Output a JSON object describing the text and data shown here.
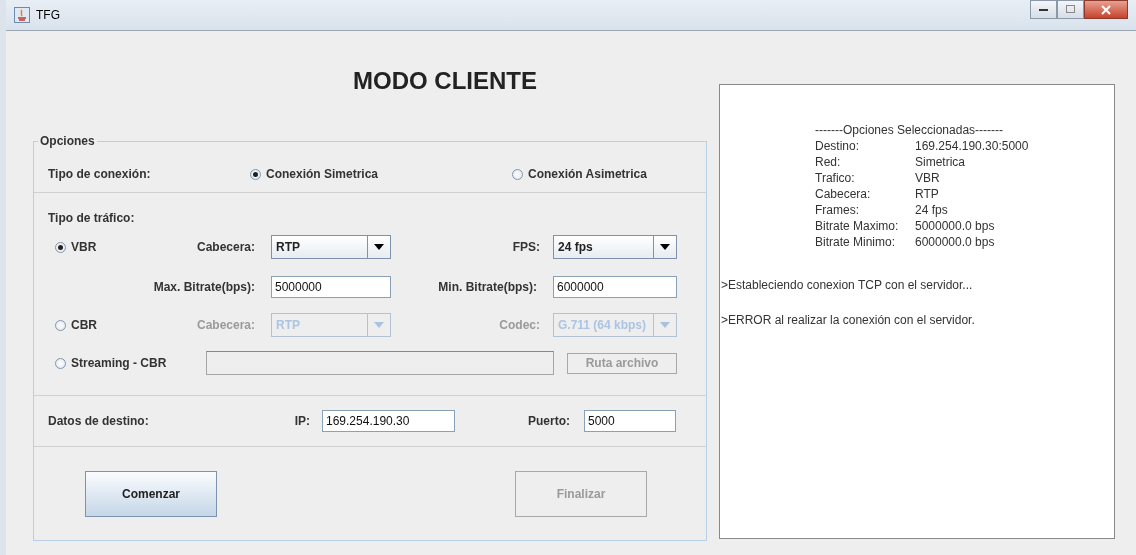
{
  "window": {
    "title": "TFG"
  },
  "heading": "MODO CLIENTE",
  "options": {
    "legend": "Opciones",
    "connection": {
      "label": "Tipo de conexión:",
      "choices": [
        {
          "label": "Conexión Simetrica",
          "selected": true
        },
        {
          "label": "Conexión Asimetrica",
          "selected": false
        }
      ]
    },
    "traffic_label": "Tipo de tráfico:",
    "vbr": {
      "label": "VBR",
      "selected": true,
      "header": {
        "label": "Cabecera:",
        "value": "RTP",
        "disabled": false
      },
      "fps": {
        "label": "FPS:",
        "value": "24 fps",
        "disabled": false
      },
      "max_bitrate": {
        "label": "Max. Bitrate(bps):",
        "value": "5000000"
      },
      "min_bitrate": {
        "label": "Min. Bitrate(bps):",
        "value": "6000000"
      }
    },
    "cbr": {
      "label": "CBR",
      "selected": false,
      "header": {
        "label": "Cabecera:",
        "value": "RTP",
        "disabled": true
      },
      "codec": {
        "label": "Codec:",
        "value": "G.711 (64 kbps)",
        "disabled": true
      }
    },
    "streaming": {
      "label": "Streaming - CBR",
      "selected": false,
      "path_disabled": true,
      "browse_button": {
        "label": "Ruta archivo",
        "disabled": true
      }
    },
    "destination": {
      "label": "Datos de destino:",
      "ip": {
        "label": "IP:",
        "value": "169.254.190.30"
      },
      "port": {
        "label": "Puerto:",
        "value": "5000"
      }
    },
    "buttons": [
      {
        "label": "Comenzar",
        "disabled": false
      },
      {
        "label": "Finalizar",
        "disabled": true
      }
    ]
  },
  "log": {
    "summary_title": "-------Opciones Seleccionadas-------",
    "summary": [
      {
        "key": "Destino:",
        "value": "169.254.190.30:5000"
      },
      {
        "key": "Red:",
        "value": "Simetrica"
      },
      {
        "key": "Trafico:",
        "value": "VBR"
      },
      {
        "key": "Cabecera:",
        "value": "RTP"
      },
      {
        "key": "Frames:",
        "value": "24 fps"
      },
      {
        "key": "Bitrate Maximo:",
        "value": "5000000.0 bps"
      },
      {
        "key": "Bitrate Minimo:",
        "value": "6000000.0 bps"
      }
    ],
    "messages": [
      ">Estableciendo conexion TCP con el servidor...",
      ">ERROR al realizar la conexión con el servidor."
    ]
  }
}
